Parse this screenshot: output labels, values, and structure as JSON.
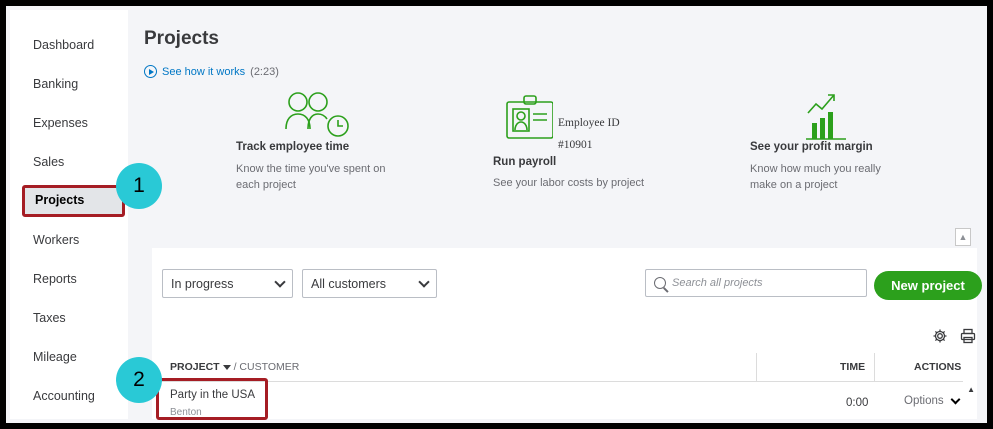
{
  "sidebar": {
    "items": [
      {
        "label": "Dashboard"
      },
      {
        "label": "Banking"
      },
      {
        "label": "Expenses"
      },
      {
        "label": "Sales"
      },
      {
        "label": "Projects"
      },
      {
        "label": "Workers"
      },
      {
        "label": "Reports"
      },
      {
        "label": "Taxes"
      },
      {
        "label": "Mileage"
      },
      {
        "label": "Accounting"
      }
    ],
    "active": "Projects"
  },
  "page": {
    "title": "Projects",
    "see_how_label": "See how it works",
    "see_how_duration": "(2:23)"
  },
  "features": [
    {
      "title": "Track employee time",
      "desc": "Know the time you've spent on each project",
      "icon": "employees-clock-icon"
    },
    {
      "title": "Run payroll",
      "desc": "See your labor costs by project",
      "icon": "employee-id-badge-icon",
      "badge_label": "Employee ID",
      "badge_number": "#10901"
    },
    {
      "title": "See your profit margin",
      "desc": "Know how much you really make on a project",
      "icon": "profit-chart-icon"
    }
  ],
  "filters": {
    "status": "In progress",
    "customer": "All customers",
    "search_placeholder": "Search all projects",
    "new_button": "New project"
  },
  "table": {
    "col_project": "PROJECT",
    "col_customer": "/ CUSTOMER",
    "col_time": "TIME",
    "col_actions": "ACTIONS",
    "rows": [
      {
        "project": "Party in the USA",
        "customer": "Benton",
        "time": "0:00",
        "action": "Options"
      }
    ]
  },
  "callouts": {
    "one": "1",
    "two": "2"
  },
  "colors": {
    "accent_green": "#2ca01c",
    "link_blue": "#0077c5",
    "highlight_red": "#a51d24",
    "callout_teal": "#29c9d6"
  }
}
